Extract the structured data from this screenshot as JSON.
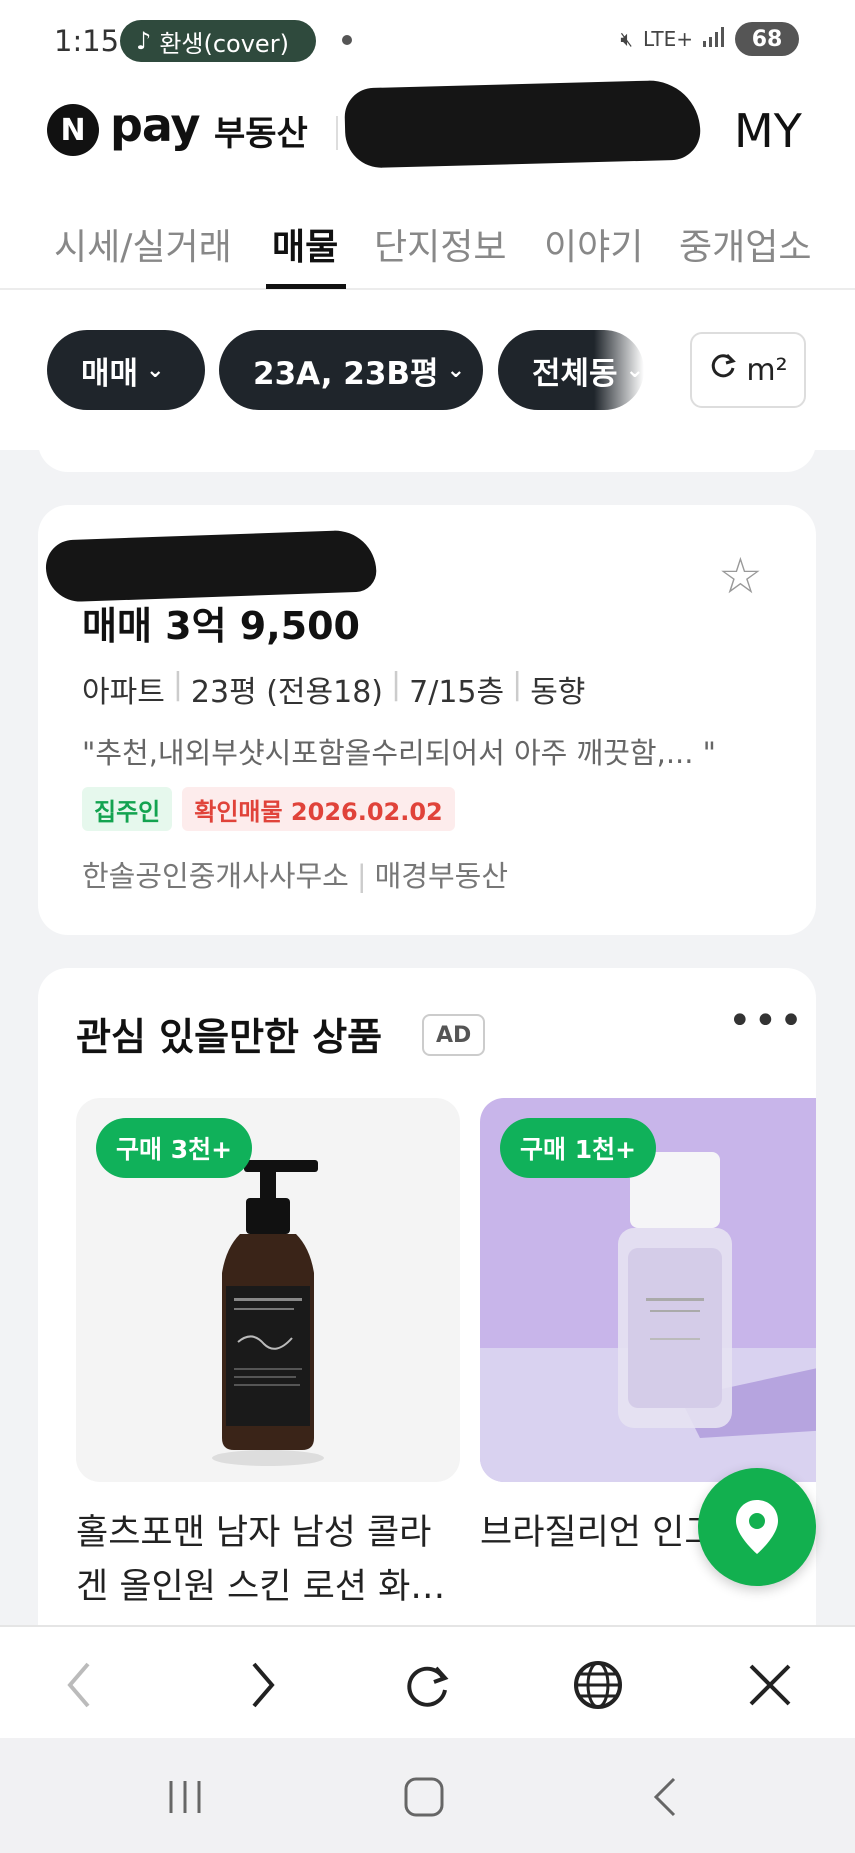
{
  "status_bar": {
    "time": "1:15",
    "media_pill": "환생(cover)",
    "network": "LTE+",
    "battery": "68"
  },
  "header": {
    "logo_letter": "N",
    "logo_pay": "pay",
    "logo_service": "부동산",
    "my_label": "MY"
  },
  "tabs": [
    "시세/실거래",
    "매물",
    "단지정보",
    "이야기",
    "중개업소"
  ],
  "active_tab": "매물",
  "filters": {
    "chips": [
      "매매",
      "23A, 23B평",
      "전체동"
    ],
    "area_unit": "m²"
  },
  "listing": {
    "price": "매매 3억 9,500",
    "specs": [
      "아파트",
      "23평 (전용18)",
      "7/15층",
      "동향"
    ],
    "description": "\"추천,내외부샷시포함올수리되어서 아주 깨끗함,...   \"",
    "badges": [
      "집주인",
      "확인매물 2026.02.02"
    ],
    "agents": [
      "한솔공인중개사사무소",
      "매경부동산"
    ]
  },
  "ad_section": {
    "title": "관심 있을만한 상품",
    "tag": "AD",
    "more": "•••",
    "products": [
      {
        "badge": "구매 3천+",
        "name": "홀츠포맨 남자 남성 콜라겐 올인원 스킨 로션 화…",
        "image": "bottle-pump"
      },
      {
        "badge": "구매 1천+",
        "name": "브라질리언 인그 프레이 센시티브 - 인그",
        "image": "bottle-spray"
      }
    ]
  },
  "colors": {
    "accent_green": "#12b04f",
    "chip_dark": "#1f252b",
    "owner_badge": "#13a350",
    "verify_badge": "#e0433a"
  },
  "browser_bar": [
    "back",
    "forward",
    "reload",
    "globe",
    "close"
  ],
  "system_nav": [
    "recents",
    "home",
    "back"
  ]
}
